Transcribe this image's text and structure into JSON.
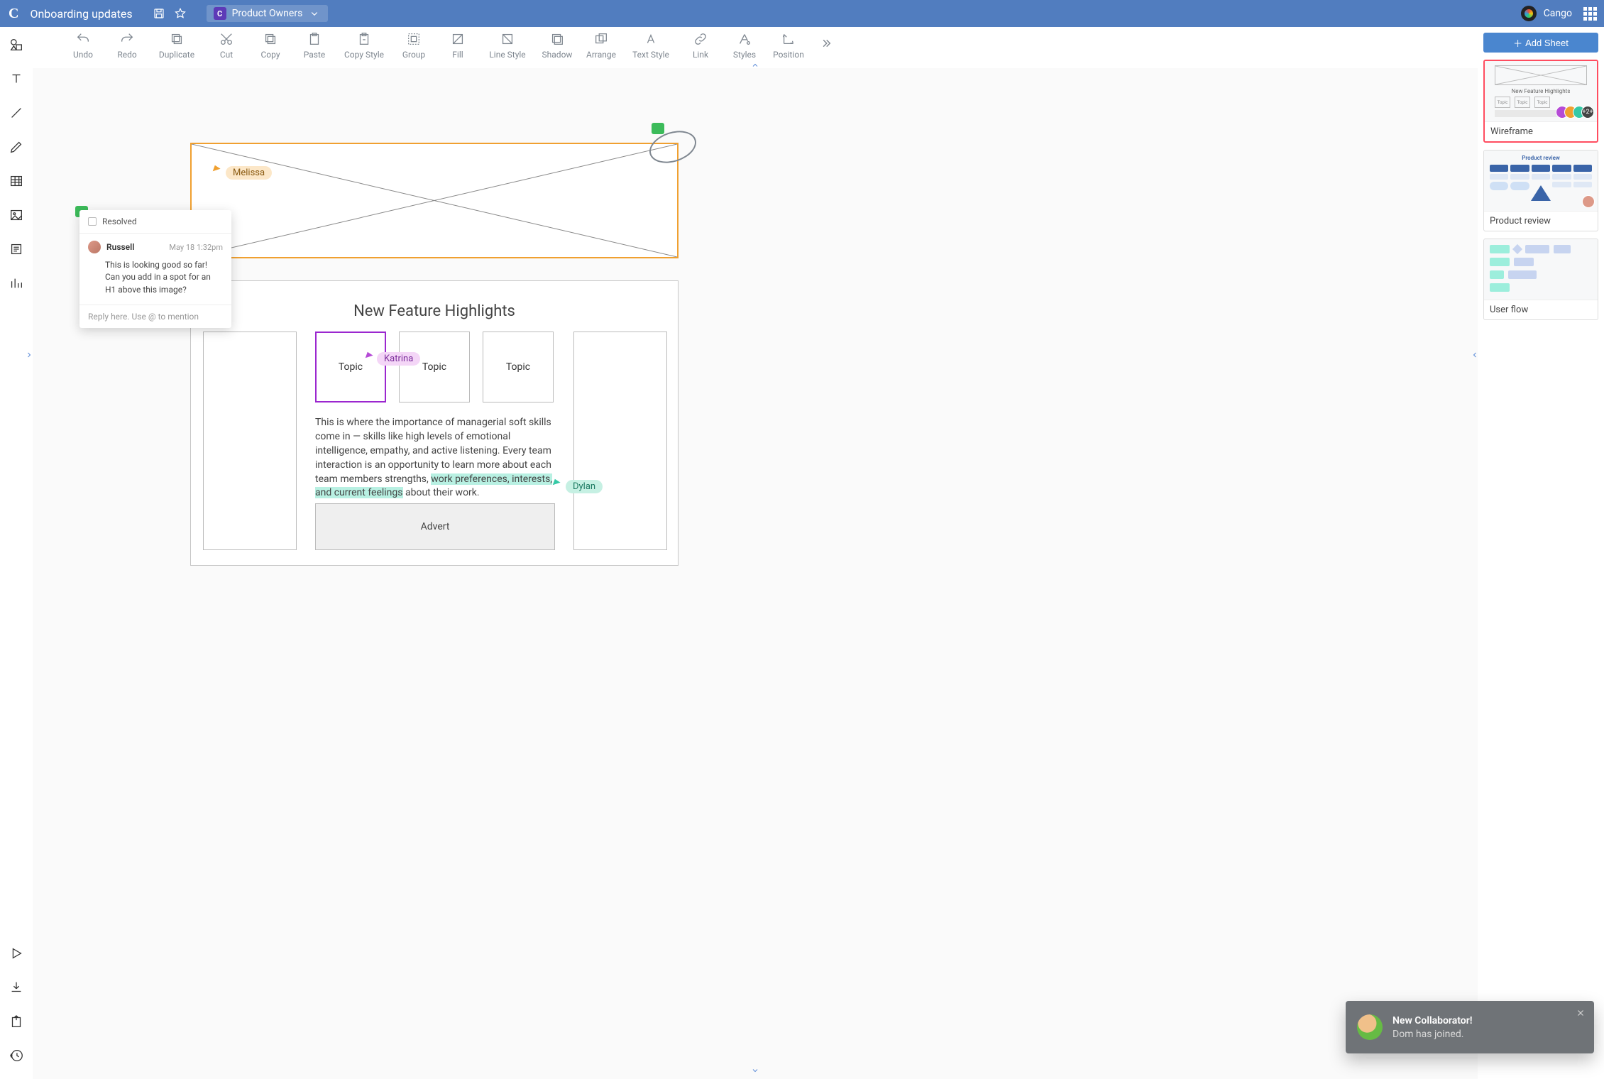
{
  "header": {
    "doc_title": "Onboarding updates",
    "team_chip": {
      "badge": "C",
      "label": "Product Owners"
    },
    "brand": "Cango"
  },
  "toolbar": {
    "items": [
      {
        "id": "undo",
        "label": "Undo"
      },
      {
        "id": "redo",
        "label": "Redo"
      },
      {
        "id": "duplicate",
        "label": "Duplicate"
      },
      {
        "id": "cut",
        "label": "Cut"
      },
      {
        "id": "copy",
        "label": "Copy"
      },
      {
        "id": "paste",
        "label": "Paste"
      },
      {
        "id": "copy-style",
        "label": "Copy Style"
      },
      {
        "id": "group",
        "label": "Group"
      },
      {
        "id": "fill",
        "label": "Fill"
      },
      {
        "id": "line-style",
        "label": "Line Style"
      },
      {
        "id": "shadow",
        "label": "Shadow"
      },
      {
        "id": "arrange",
        "label": "Arrange"
      },
      {
        "id": "text-style",
        "label": "Text Style"
      },
      {
        "id": "link",
        "label": "Link"
      },
      {
        "id": "styles",
        "label": "Styles"
      },
      {
        "id": "position",
        "label": "Position"
      }
    ]
  },
  "cursors": {
    "melissa": {
      "name": "Melissa",
      "color": "#f0a030",
      "bg": "#fce7c8"
    },
    "katrina": {
      "name": "Katrina",
      "color": "#b54bd6",
      "bg": "#f4d6f7"
    },
    "dylan": {
      "name": "Dylan",
      "color": "#35c9a6",
      "bg": "#c6f0e3"
    }
  },
  "wireframe": {
    "panel_heading": "New Feature Highlights",
    "topics": [
      "Topic",
      "Topic",
      "Topic"
    ],
    "body_text_pre": "This is where the importance of managerial soft skills come in — skills like high levels of emotional intelligence, empathy, and active listening. Every team interaction is an opportunity to learn more about each team members strengths, ",
    "body_text_hl": "work preferences, interests, and current feelings",
    "body_text_post": " about their work.",
    "advert": "Advert"
  },
  "comment_card": {
    "resolved_label": "Resolved",
    "author": "Russell",
    "timestamp": "May 18 1:32pm",
    "body": "This is looking good so far! Can you add in a spot for an H1 above this image?",
    "reply_placeholder": "Reply here. Use @ to mention"
  },
  "right_panel": {
    "add_sheet": "Add Sheet",
    "sheets": [
      {
        "id": "wireframe",
        "label": "Wireframe",
        "active": true,
        "avatars_more": "+2+",
        "thumb_caption": "New Feature Highlights",
        "thumb_topics": [
          "Topic",
          "Topic",
          "Topic"
        ]
      },
      {
        "id": "product-review",
        "label": "Product review",
        "active": false,
        "thumb_title": "Product review"
      },
      {
        "id": "user-flow",
        "label": "User flow",
        "active": false
      }
    ]
  },
  "toast": {
    "title": "New Collaborator!",
    "subtitle": "Dom has joined."
  }
}
